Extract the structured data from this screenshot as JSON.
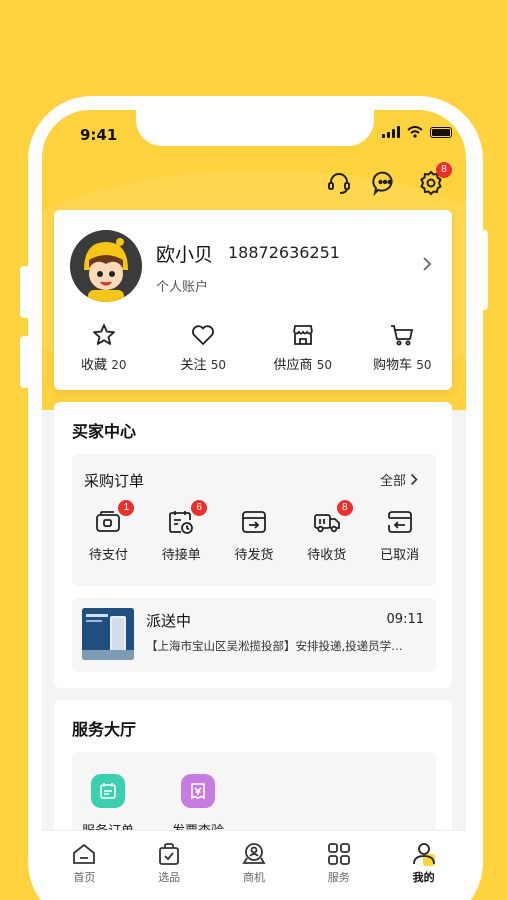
{
  "status_bar": {
    "time": "9:41"
  },
  "header": {
    "icons": [
      "headset-icon",
      "chat-icon",
      "gear-icon"
    ],
    "settings_badge": "8"
  },
  "profile": {
    "name": "欧小贝",
    "phone": "18872636251",
    "account_type": "个人账户",
    "stats": [
      {
        "label": "收藏",
        "count": "20",
        "icon": "star-icon"
      },
      {
        "label": "关注",
        "count": "50",
        "icon": "heart-icon"
      },
      {
        "label": "供应商",
        "count": "50",
        "icon": "store-icon"
      },
      {
        "label": "购物车",
        "count": "50",
        "icon": "cart-icon"
      }
    ]
  },
  "buyer_center": {
    "title": "买家中心",
    "orders": {
      "title": "采购订单",
      "all_label": "全部",
      "items": [
        {
          "label": "待支付",
          "badge": "1",
          "icon": "wallet-icon"
        },
        {
          "label": "待接单",
          "badge": "6",
          "icon": "calendar-clock-icon"
        },
        {
          "label": "待发货",
          "badge": "",
          "icon": "box-arrow-icon"
        },
        {
          "label": "待收货",
          "badge": "8",
          "icon": "truck-icon"
        },
        {
          "label": "已取消",
          "badge": "",
          "icon": "return-icon"
        }
      ]
    },
    "delivery": {
      "status": "派送中",
      "time": "09:11",
      "message": "【上海市宝山区吴淞揽投部】安排投递,投递员学…"
    }
  },
  "services": {
    "title": "服务大厅",
    "items": [
      {
        "label": "服务订单",
        "icon": "service-order-icon",
        "color": "#3CCFB0"
      },
      {
        "label": "发票查验",
        "icon": "invoice-icon",
        "color": "#C77BE0"
      }
    ]
  },
  "tabbar": {
    "items": [
      {
        "label": "首页",
        "icon": "home-icon"
      },
      {
        "label": "选品",
        "icon": "bag-check-icon"
      },
      {
        "label": "商机",
        "icon": "opportunity-icon"
      },
      {
        "label": "服务",
        "icon": "grid-icon"
      },
      {
        "label": "我的",
        "icon": "user-icon",
        "active": true
      }
    ]
  },
  "colors": {
    "brand": "#FFD23F",
    "badge": "#E8312A"
  }
}
